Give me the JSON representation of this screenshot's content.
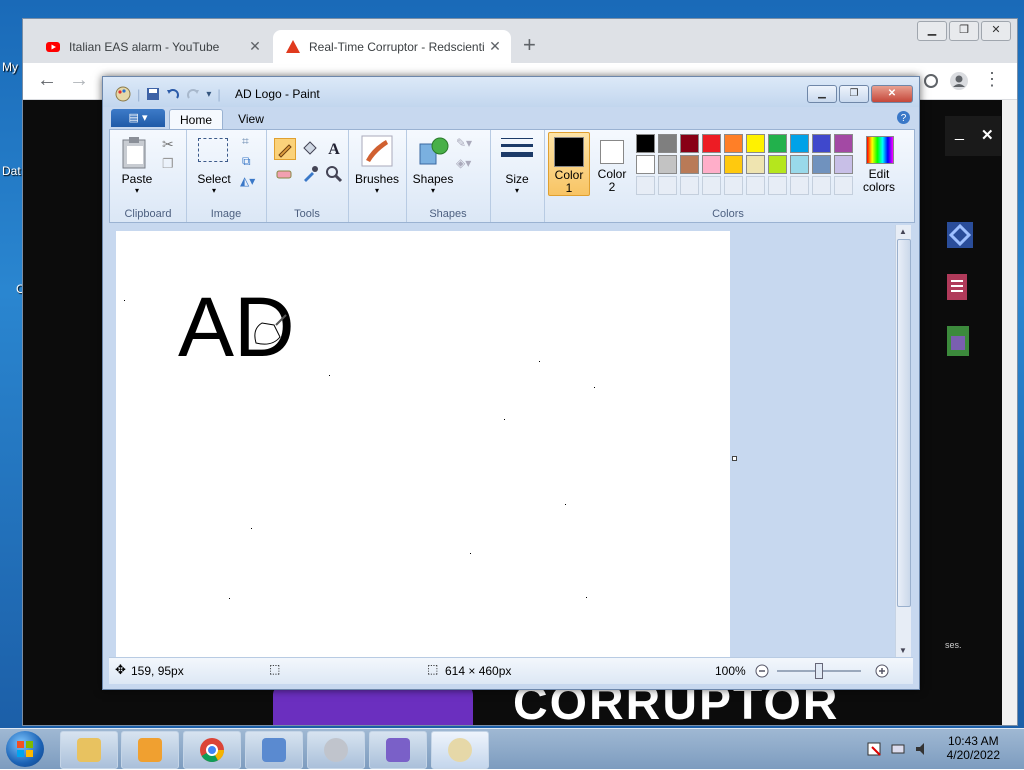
{
  "desktop": {
    "labels": [
      "My",
      "Dat",
      "C"
    ]
  },
  "chrome": {
    "tabs": [
      {
        "title": "Italian EAS alarm - YouTube",
        "favicon_color": "#ff0000",
        "active": false
      },
      {
        "title": "Real-Time Corruptor - Redscienti",
        "favicon_color": "#e03a1e",
        "active": true
      }
    ],
    "new_tab_label": "+",
    "tab_close_label": "✕",
    "back_icon": "←",
    "forward_icon": "→",
    "page": {
      "corruptor_text": "CORRUPTOR",
      "panel_close": "✕",
      "panel_minimize": "_",
      "side_note": "ses."
    }
  },
  "paint": {
    "title": "AD Logo - Paint",
    "menu_label": "▤ ▾",
    "tabs": [
      "Home",
      "View"
    ],
    "groups": {
      "clipboard": {
        "label": "Clipboard",
        "paste": "Paste"
      },
      "image": {
        "label": "Image",
        "select": "Select"
      },
      "tools": {
        "label": "Tools"
      },
      "brushes": {
        "label": "Brushes"
      },
      "shapes": {
        "label": "Shapes",
        "shapes": "Shapes"
      },
      "size": {
        "label": "Size"
      },
      "colors": {
        "label": "Colors",
        "color1": "Color\n1",
        "color1_a": "Color",
        "color1_b": "1",
        "color2_a": "Color",
        "color2_b": "2",
        "edit_a": "Edit",
        "edit_b": "colors"
      }
    },
    "palette_row1": [
      "#000000",
      "#7f7f7f",
      "#880015",
      "#ed1c24",
      "#ff7f27",
      "#fff200",
      "#22b14c",
      "#00a2e8",
      "#3f48cc",
      "#a349a4"
    ],
    "palette_row2": [
      "#ffffff",
      "#c3c3c3",
      "#b97a57",
      "#ffaec9",
      "#ffc90e",
      "#efe4b0",
      "#b5e61d",
      "#99d9ea",
      "#7092be",
      "#c8bfe7"
    ],
    "canvas_text": "AD",
    "status": {
      "cursor_pos": "159, 95px",
      "image_size": "614 × 460px",
      "zoom": "100%"
    }
  },
  "taskbar": {
    "time": "10:43 AM",
    "date": "4/20/2022",
    "items": [
      "explorer",
      "media-player",
      "chrome",
      "control-panel",
      "sound",
      "vegas",
      "paint"
    ]
  }
}
